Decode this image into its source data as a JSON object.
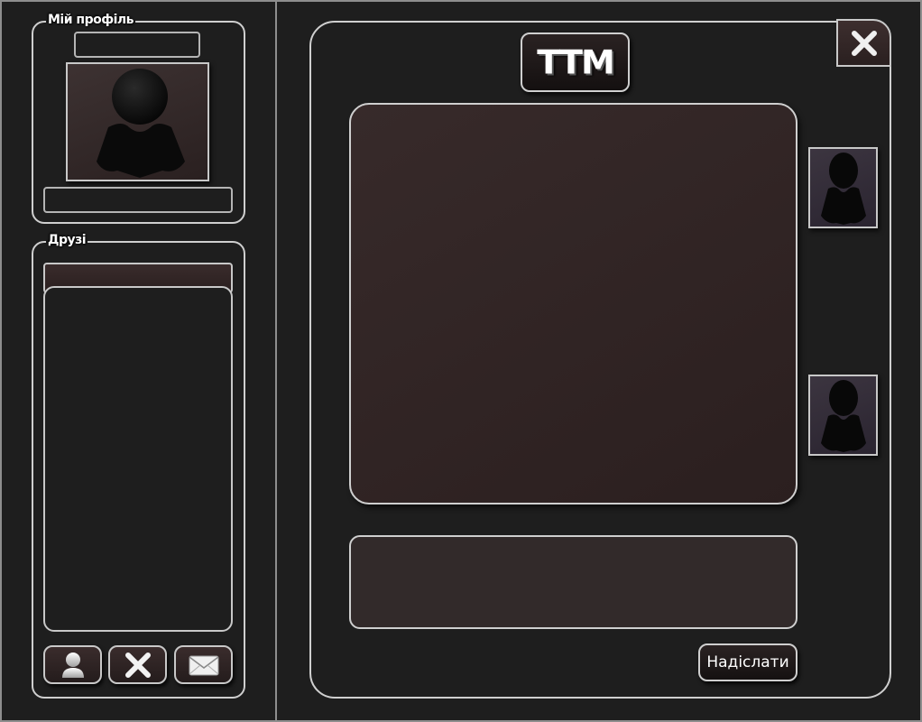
{
  "profile": {
    "title": "Мій профіль",
    "username_value": "",
    "status_value": ""
  },
  "friends": {
    "title": "Друзі",
    "list_header_value": "",
    "items": [],
    "buttons": {
      "profile_icon": "user-icon",
      "remove_icon": "close-icon",
      "message_icon": "envelope-icon"
    }
  },
  "chat": {
    "logo_text": "TTM",
    "close_icon": "close-icon",
    "messages": [],
    "input_value": "",
    "send_label": "Надіслати",
    "participants": [
      "avatar-1",
      "avatar-2"
    ]
  },
  "colors": {
    "background": "#1e1e1e",
    "border": "#cfcfcf",
    "panel_accent": "#2b1f1f"
  }
}
